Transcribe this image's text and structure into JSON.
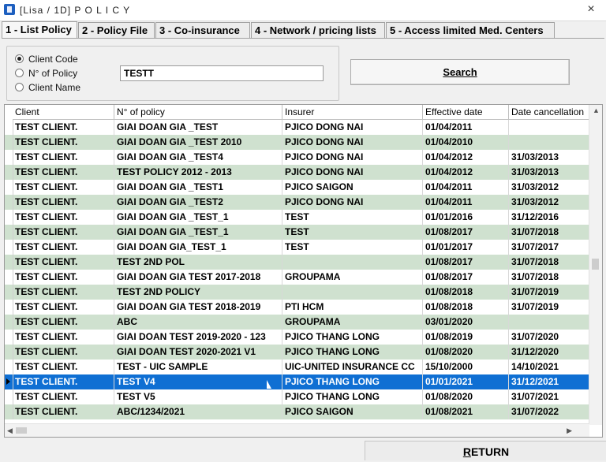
{
  "window": {
    "title": "[Lisa / 1D] P O L I C Y",
    "close_glyph": "×"
  },
  "tabs": [
    {
      "label": "1 - List Policy",
      "active": true
    },
    {
      "label": "2 - Policy File"
    },
    {
      "label": "3 - Co-insurance"
    },
    {
      "label": "4 - Network / pricing lists"
    },
    {
      "label": "5 - Access limited Med. Centers"
    }
  ],
  "search": {
    "options": [
      {
        "label": "Client Code",
        "selected": true
      },
      {
        "label": "N° of Policy",
        "selected": false
      },
      {
        "label": "Client Name",
        "selected": false
      }
    ],
    "value": "TESTT",
    "button_label": "Search"
  },
  "table": {
    "columns": [
      "Client",
      "N° of policy",
      "Insurer",
      "Effective date",
      "Date cancellation"
    ],
    "rows": [
      [
        "TEST CLIENT.",
        "GIAI DOAN GIA _TEST",
        "PJICO DONG NAI",
        "01/04/2011",
        ""
      ],
      [
        "TEST CLIENT.",
        "GIAI DOAN GIA _TEST 2010",
        "PJICO DONG NAI",
        "01/04/2010",
        ""
      ],
      [
        "TEST CLIENT.",
        "GIAI DOAN GIA _TEST4",
        "PJICO DONG NAI",
        "01/04/2012",
        "31/03/2013"
      ],
      [
        "TEST CLIENT.",
        "TEST POLICY 2012 - 2013",
        "PJICO DONG NAI",
        "01/04/2012",
        "31/03/2013"
      ],
      [
        "TEST CLIENT.",
        "GIAI DOAN GIA _TEST1",
        "PJICO SAIGON",
        "01/04/2011",
        "31/03/2012"
      ],
      [
        "TEST CLIENT.",
        "GIAI DOAN GIA _TEST2",
        "PJICO DONG NAI",
        "01/04/2011",
        "31/03/2012"
      ],
      [
        "TEST CLIENT.",
        "GIAI DOAN GIA _TEST_1",
        "TEST",
        "01/01/2016",
        "31/12/2016"
      ],
      [
        "TEST CLIENT.",
        "GIAI DOAN GIA _TEST_1",
        "TEST",
        "01/08/2017",
        "31/07/2018"
      ],
      [
        "TEST CLIENT.",
        "GIAI DOAN GIA_TEST_1",
        "TEST",
        "01/01/2017",
        "31/07/2017"
      ],
      [
        "TEST CLIENT.",
        "TEST 2ND POL",
        "",
        "01/08/2017",
        "31/07/2018"
      ],
      [
        "TEST CLIENT.",
        "GIAI DOAN GIA  TEST 2017-2018",
        "GROUPAMA",
        "01/08/2017",
        "31/07/2018"
      ],
      [
        "TEST CLIENT.",
        "TEST 2ND POLICY",
        "",
        "01/08/2018",
        "31/07/2019"
      ],
      [
        "TEST CLIENT.",
        "GIAI DOAN GIA TEST 2018-2019",
        "PTI HCM",
        "01/08/2018",
        "31/07/2019"
      ],
      [
        "TEST CLIENT.",
        "ABC",
        "GROUPAMA",
        "03/01/2020",
        ""
      ],
      [
        "TEST CLIENT.",
        "GIAI DOAN TEST 2019-2020 - 123",
        "PJICO THANG LONG",
        "01/08/2019",
        "31/07/2020"
      ],
      [
        "TEST CLIENT.",
        "GIAI DOAN TEST 2020-2021 V1",
        "PJICO THANG LONG",
        "01/08/2020",
        "31/12/2020"
      ],
      [
        "TEST CLIENT.",
        "TEST - UIC SAMPLE",
        "UIC-UNITED INSURANCE CC",
        "15/10/2000",
        "14/10/2021"
      ],
      [
        "TEST CLIENT.",
        "TEST V4",
        "PJICO THANG LONG",
        "01/01/2021",
        "31/12/2021"
      ],
      [
        "TEST CLIENT.",
        "TEST V5",
        "PJICO THANG LONG",
        "01/08/2020",
        "31/07/2021"
      ],
      [
        "TEST CLIENT.",
        "ABC/1234/2021",
        "PJICO SAIGON",
        "01/08/2021",
        "31/07/2022"
      ]
    ],
    "selected_row": 17
  },
  "return_button": {
    "prefix": "R",
    "rest": "ETURN"
  },
  "colors": {
    "selected_row": "#0f6fd3",
    "alt_row": "#cfe1cf"
  }
}
